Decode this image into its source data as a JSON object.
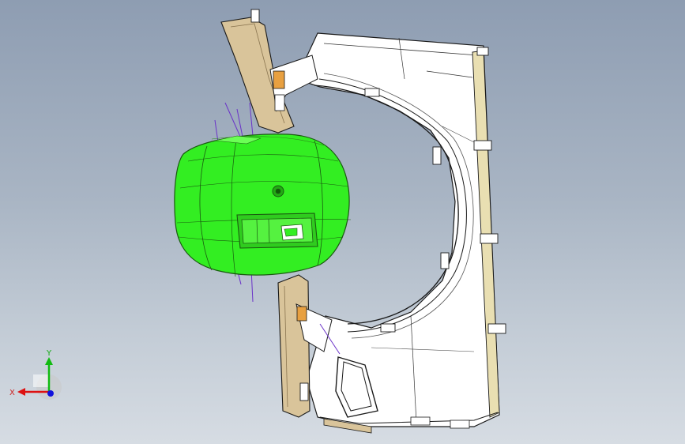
{
  "viewport": {
    "background_top": "#8e9db2",
    "background_bottom": "#d6dce3"
  },
  "model": {
    "highlight_color": "#33ee22",
    "body_color": "#ffffff",
    "trim_color": "#d9c49a",
    "edge_color": "#1a1a1a"
  },
  "triad": {
    "x_label": "X",
    "y_label": "Y",
    "x_color": "#dd1111",
    "y_color": "#11bb11",
    "z_color": "#1111dd"
  }
}
